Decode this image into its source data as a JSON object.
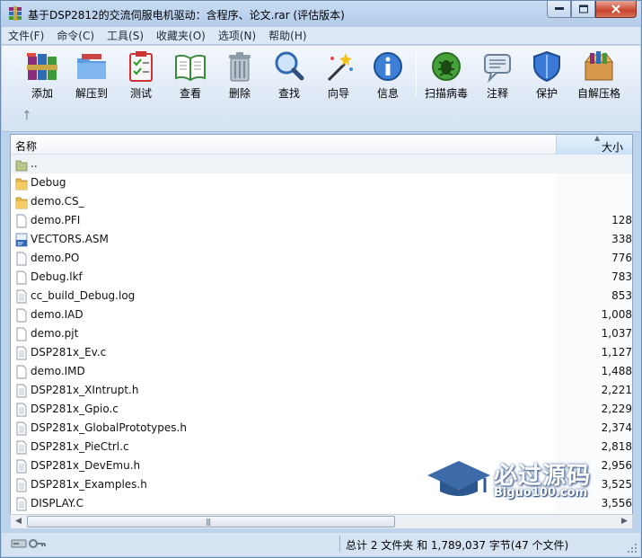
{
  "window": {
    "title": "基于DSP2812的交流伺服电机驱动：含程序、论文.rar (评估版本)"
  },
  "menu": [
    "文件(F)",
    "命令(C)",
    "工具(S)",
    "收藏夹(O)",
    "选项(N)",
    "帮助(H)"
  ],
  "toolbar": {
    "buttons": [
      {
        "label": "添加",
        "icon": "add-books-icon"
      },
      {
        "label": "解压到",
        "icon": "extract-folder-icon"
      },
      {
        "label": "测试",
        "icon": "test-clipboard-icon"
      },
      {
        "label": "查看",
        "icon": "view-book-icon"
      },
      {
        "label": "删除",
        "icon": "trash-can-icon"
      },
      {
        "label": "查找",
        "icon": "magnifier-icon"
      },
      {
        "label": "向导",
        "icon": "wizard-wand-icon"
      },
      {
        "label": "信息",
        "icon": "info-icon"
      },
      {
        "label": "扫描病毒",
        "icon": "virus-scan-icon"
      },
      {
        "label": "注释",
        "icon": "comment-icon"
      },
      {
        "label": "保护",
        "icon": "shield-icon"
      },
      {
        "label": "自解压格",
        "icon": "sfx-box-icon"
      }
    ],
    "up_symbol": "↑"
  },
  "list": {
    "columns": {
      "name": "名称",
      "size": "大小"
    },
    "rows": [
      {
        "name": "..",
        "size": "",
        "icon": "parent-folder"
      },
      {
        "name": "Debug",
        "size": "",
        "icon": "folder"
      },
      {
        "name": "demo.CS_",
        "size": "",
        "icon": "folder"
      },
      {
        "name": "demo.PFI",
        "size": "128",
        "icon": "file"
      },
      {
        "name": "VECTORS.ASM",
        "size": "338",
        "icon": "asm"
      },
      {
        "name": "demo.PO",
        "size": "776",
        "icon": "file"
      },
      {
        "name": "Debug.lkf",
        "size": "783",
        "icon": "file"
      },
      {
        "name": "cc_build_Debug.log",
        "size": "853",
        "icon": "text"
      },
      {
        "name": "demo.IAD",
        "size": "1,008",
        "icon": "file"
      },
      {
        "name": "demo.pjt",
        "size": "1,037",
        "icon": "file"
      },
      {
        "name": "DSP281x_Ev.c",
        "size": "1,127",
        "icon": "text"
      },
      {
        "name": "demo.IMD",
        "size": "1,488",
        "icon": "file"
      },
      {
        "name": "DSP281x_XIntrupt.h",
        "size": "2,221",
        "icon": "text"
      },
      {
        "name": "DSP281x_Gpio.c",
        "size": "2,229",
        "icon": "text"
      },
      {
        "name": "DSP281x_GlobalPrototypes.h",
        "size": "2,374",
        "icon": "text"
      },
      {
        "name": "DSP281x_PieCtrl.c",
        "size": "2,818",
        "icon": "text"
      },
      {
        "name": "DSP281x_DevEmu.h",
        "size": "2,956",
        "icon": "text"
      },
      {
        "name": "DSP281x_Examples.h",
        "size": "3,525",
        "icon": "text"
      },
      {
        "name": "DISPLAY.C",
        "size": "3,556",
        "icon": "text"
      }
    ]
  },
  "scrollbar": {
    "grip": "|||"
  },
  "status": {
    "summary": "总计 2 文件夹 和 1,789,037 字节(47 个文件)"
  },
  "watermark": {
    "title": "必过源码",
    "url": "Biguo100.com"
  },
  "colors": {
    "titlebar": "#bcd3ec",
    "close_button": "#c7452c",
    "folder": "#e8b84a",
    "watermark": "#3d6aa8"
  }
}
